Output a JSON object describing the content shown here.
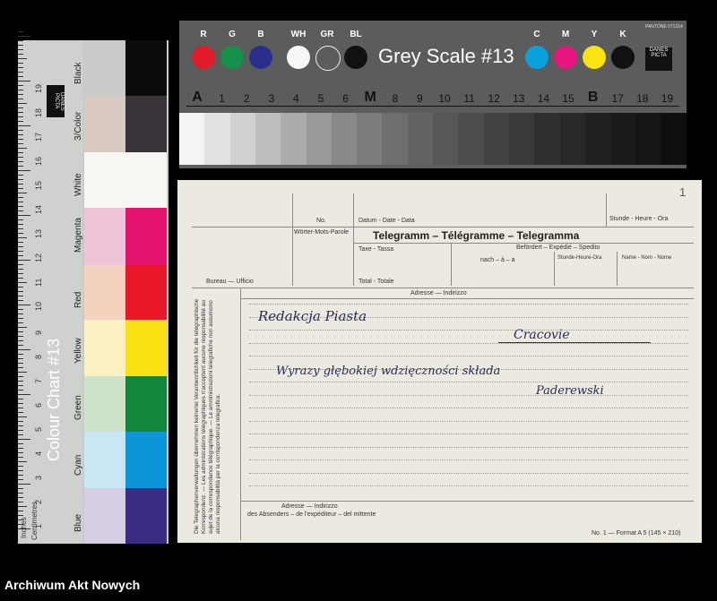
{
  "colour_chart": {
    "title": "Colour Chart #13",
    "inches_label": "Inches",
    "cm_label": "Centimetres",
    "logo": "DANES PICTA",
    "ruler_numbers": [
      "1",
      "2",
      "3",
      "4",
      "5",
      "6",
      "7",
      "8",
      "9",
      "10",
      "11",
      "12",
      "13",
      "14",
      "15",
      "16",
      "17",
      "18",
      "19"
    ],
    "swatches": [
      {
        "label": "Black",
        "light": "#c8cbc9",
        "dark": "#0c0c0c"
      },
      {
        "label": "3/Color",
        "light": "#d8c9c1",
        "dark": "#3a333a"
      },
      {
        "label": "White",
        "light": "#f6f6f2",
        "dark": "#f6f6f2"
      },
      {
        "label": "Magenta",
        "light": "#efc4d8",
        "dark": "#e4136f"
      },
      {
        "label": "Red",
        "light": "#f5d2c0",
        "dark": "#e8172a"
      },
      {
        "label": "Yellow",
        "light": "#fbf1c2",
        "dark": "#fbe114"
      },
      {
        "label": "Green",
        "light": "#cfe3c8",
        "dark": "#12873b"
      },
      {
        "label": "Cyan",
        "light": "#c8e6f3",
        "dark": "#0c95d8"
      },
      {
        "label": "Blue",
        "light": "#d5cde4",
        "dark": "#3a2c83"
      }
    ]
  },
  "grey_scale": {
    "title": "Grey Scale #13",
    "small_text": "PANTONE 071314",
    "logo": "DANES PICTA",
    "dots": [
      {
        "label": "R",
        "color": "#e21b2a"
      },
      {
        "label": "G",
        "color": "#15914a"
      },
      {
        "label": "B",
        "color": "#2a2f8e"
      },
      {
        "label": "WH",
        "color": "#f7f7f7"
      },
      {
        "label": "GR",
        "color": "#5b5d5c"
      },
      {
        "label": "BL",
        "color": "#111111"
      },
      {
        "label": "C",
        "color": "#0aa0dc"
      },
      {
        "label": "M",
        "color": "#e8167f"
      },
      {
        "label": "Y",
        "color": "#fbe213"
      },
      {
        "label": "K",
        "color": "#111111"
      }
    ],
    "scale_labels": [
      "A",
      "1",
      "2",
      "3",
      "4",
      "5",
      "6",
      "M",
      "8",
      "9",
      "10",
      "11",
      "12",
      "13",
      "14",
      "15",
      "B",
      "17",
      "18",
      "19"
    ],
    "steps": [
      "#f4f4f4",
      "#e2e2e2",
      "#cfd0d0",
      "#bdbebe",
      "#aaabab",
      "#989999",
      "#888989",
      "#7b7c7c",
      "#6e6f6f",
      "#626363",
      "#565757",
      "#4b4c4c",
      "#414242",
      "#383939",
      "#2f3030",
      "#272828",
      "#202121",
      "#1a1b1b",
      "#141515",
      "#0f0f0f"
    ]
  },
  "telegram": {
    "page_number": "1",
    "no_label": "No.",
    "words_label": "Wörter-Mots-Parole",
    "date_label": "Datum - Date - Data",
    "time_label": "Stunde - Heure - Ora",
    "title": "Telegramm – Télégramme – Telegramma",
    "forwarded_label": "Befördert – Expédié – Spedito",
    "tax_label": "Taxe - Tassa",
    "to_label": "nach – à – a",
    "hour_label": "Stunde-Heure-Ora",
    "name_label": "Name - Nom - Nome",
    "bureau_label": "Bureau — Ufficio",
    "total_label": "Total - Totale",
    "address_label": "Adresse — Indirizzo",
    "side_text": "Die Telegraphenverwaltungen übernehmen keinerlei Verantwortlichkeit für die telegraphische Korrespondenz. — Les administrations télégraphiques n'acceptent aucune responsabilité au sujet de la correspondance télégraphique. — Le amministrazioni telegrafiche non assumono alcuna responsabilità per la corrispondenza telegrafica.",
    "sender_address_label": "Adresse — Indirizzo",
    "sender_label": "des Absenders – de l'expéditeur – del mittente",
    "form_number": "No. 1 — Format A 5 (145 × 210)",
    "handwriting": {
      "line1": "Redakcja Piasta",
      "line2": "Cracovie",
      "line3": "Wyrazy głębokiej wdzięczności składa",
      "line4": "Paderewski"
    }
  },
  "archive_name": "Archiwum Akt Nowych"
}
